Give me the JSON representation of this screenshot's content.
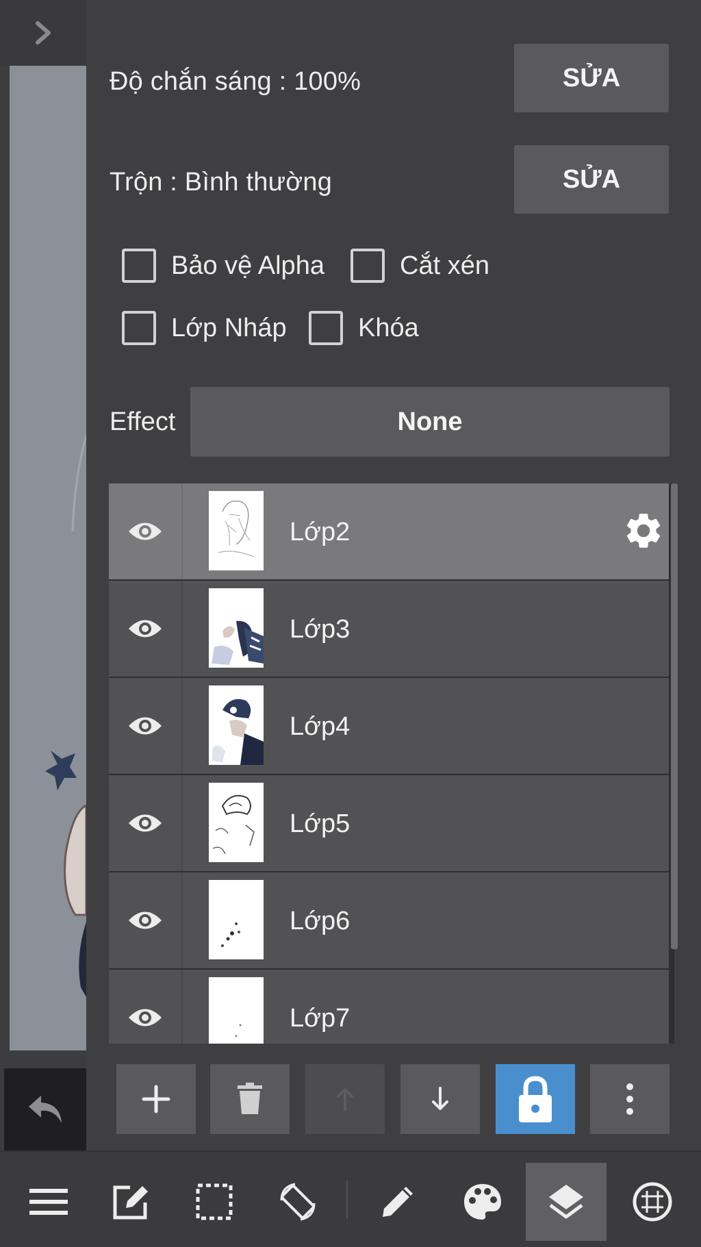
{
  "settings": {
    "opacity_label": "Độ chắn sáng : 100%",
    "opacity_edit": "SỬA",
    "blend_label": "Trộn : Bình thường",
    "blend_edit": "SỬA"
  },
  "checkboxes": {
    "protect_alpha": "Bảo vệ Alpha",
    "clipping": "Cắt xén",
    "draft_layer": "Lớp Nháp",
    "lock": "Khóa"
  },
  "effect": {
    "label": "Effect",
    "value": "None"
  },
  "layers": [
    {
      "name": "Lớp2",
      "selected": true
    },
    {
      "name": "Lớp3"
    },
    {
      "name": "Lớp4"
    },
    {
      "name": "Lớp5"
    },
    {
      "name": "Lớp6"
    },
    {
      "name": "Lớp7"
    }
  ],
  "colors": {
    "panel_bg": "#3f3f41",
    "button_bg": "#5a5a5c",
    "selected_row": "#7a7a7c",
    "row_bg": "#525254",
    "accent_blue": "#4a8fcd"
  },
  "icons": {
    "collapse": "chevron-right-icon",
    "undo": "undo-icon",
    "visibility": "eye-icon",
    "layer_settings": "gear-icon",
    "layer_tools": [
      "plus-icon",
      "trash-icon",
      "arrow-up-icon",
      "arrow-down-icon",
      "lock-icon",
      "more-vertical-icon"
    ],
    "bottom_bar": [
      "menu-icon",
      "edit-icon",
      "selection-icon",
      "rotate-screen-icon",
      "pen-icon",
      "palette-icon",
      "layers-icon",
      "grid-icon"
    ]
  }
}
